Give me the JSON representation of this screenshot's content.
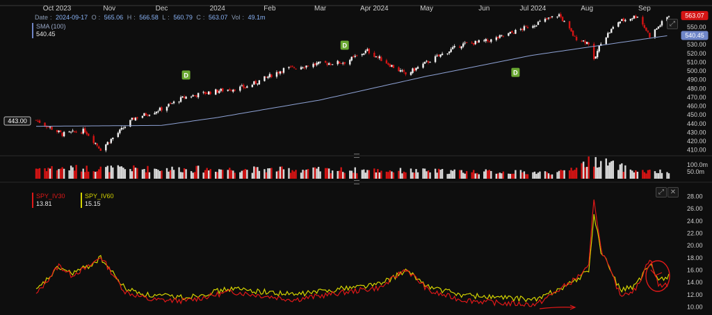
{
  "header": {
    "date_label": "Date",
    "date": "2024-09-17",
    "open_label": "O",
    "open": "565.06",
    "high_label": "H",
    "high": "566.58",
    "low_label": "L",
    "low": "560.79",
    "close_label": "C",
    "close": "563.07",
    "vol_label": "Vol",
    "vol": "49.1m"
  },
  "sma": {
    "name": "SMA (100)",
    "value": "540.45"
  },
  "price_tags": {
    "last": "563.07",
    "sma": "540.45",
    "crosshair": "443.00"
  },
  "iv_legend": {
    "iv30_name": "SPY_IV30",
    "iv30_value": "13.81",
    "iv60_name": "SPY_IV60",
    "iv60_value": "15.15"
  },
  "colors": {
    "background": "#0e0e0e",
    "up_candle": "#f2f2f2",
    "down_candle": "#d41414",
    "sma_line": "#8fa3d6",
    "iv30": "#e01818",
    "iv60": "#d4d400",
    "dividend_badge": "#6aa832",
    "annotation": "#e01818"
  },
  "toolbar_icons": [
    "expand-icon",
    "close-icon"
  ],
  "chart_data": [
    {
      "type": "candlestick",
      "title": "",
      "x_tick_labels": [
        "Oct 2023",
        "Nov",
        "Dec",
        "2024",
        "Feb",
        "Mar",
        "Apr 2024",
        "May",
        "Jun",
        "Jul 2024",
        "Aug",
        "Sep"
      ],
      "x_tick_dates": [
        "2023-10-02",
        "2023-11-01",
        "2023-12-01",
        "2024-01-02",
        "2024-02-01",
        "2024-03-01",
        "2024-04-01",
        "2024-05-01",
        "2024-06-03",
        "2024-07-01",
        "2024-08-01",
        "2024-09-03"
      ],
      "x_range": [
        "2023-09-20",
        "2024-09-17"
      ],
      "y_tick_labels": [
        "410.00",
        "420.00",
        "430.00",
        "440.00",
        "450.00",
        "460.00",
        "470.00",
        "480.00",
        "490.00",
        "500.00",
        "510.00",
        "520.00",
        "530.00",
        "540.00",
        "550.00"
      ],
      "ylim": [
        405,
        565
      ],
      "series": [
        {
          "name": "",
          "x": [
            "2023-09-20",
            "2023-10-05",
            "2023-10-18",
            "2023-10-27",
            "2023-11-15",
            "2023-11-30",
            "2023-12-14",
            "2023-12-29",
            "2024-01-19",
            "2024-02-09",
            "2024-02-28",
            "2024-03-15",
            "2024-03-28",
            "2024-04-19",
            "2024-05-03",
            "2024-05-21",
            "2024-06-07",
            "2024-06-21",
            "2024-07-16",
            "2024-07-25",
            "2024-08-02",
            "2024-08-05",
            "2024-08-09",
            "2024-08-19",
            "2024-08-30",
            "2024-09-06",
            "2024-09-17"
          ],
          "close": [
            444,
            428,
            432,
            411,
            446,
            456,
            470,
            476,
            482,
            502,
            508,
            510,
            523,
            496,
            512,
            530,
            535,
            545,
            564,
            538,
            532,
            511,
            533,
            556,
            563,
            540,
            563.07
          ]
        },
        {
          "name": "SMA (100)",
          "x": [
            "2023-09-20",
            "2023-12-01",
            "2024-01-02",
            "2024-03-01",
            "2024-05-01",
            "2024-07-01",
            "2024-09-17"
          ],
          "values": [
            437,
            438,
            447,
            467,
            494,
            518,
            540.45
          ]
        }
      ],
      "dividend_markers": [
        {
          "label": "D",
          "date": "2023-12-15",
          "value": 495
        },
        {
          "label": "D",
          "date": "2024-03-15",
          "value": 529
        },
        {
          "label": "D",
          "date": "2024-06-21",
          "value": 498
        }
      ]
    },
    {
      "type": "bar",
      "title": "",
      "y_tick_labels": [
        "100.0m",
        "50.0m"
      ],
      "ylim": [
        0,
        140
      ],
      "series": [
        {
          "name": "",
          "x": [
            "2023-09-20",
            "2023-11-15",
            "2024-01-19",
            "2024-03-15",
            "2024-05-21",
            "2024-07-16",
            "2024-08-05",
            "2024-08-30",
            "2024-09-17"
          ],
          "values": [
            80,
            75,
            70,
            65,
            55,
            45,
            140,
            55,
            49.1
          ]
        }
      ]
    },
    {
      "type": "line",
      "title": "",
      "y_tick_labels": [
        "10.00",
        "12.00",
        "14.00",
        "16.00",
        "18.00",
        "20.00",
        "22.00",
        "24.00",
        "26.00",
        "28.00"
      ],
      "ylim": [
        9.5,
        28.5
      ],
      "series": [
        {
          "name": "SPY_IV30",
          "x": [
            "2023-09-20",
            "2023-10-03",
            "2023-10-10",
            "2023-10-20",
            "2023-10-27",
            "2023-11-10",
            "2023-11-24",
            "2023-12-15",
            "2024-01-10",
            "2024-02-15",
            "2024-03-15",
            "2024-04-05",
            "2024-04-19",
            "2024-05-03",
            "2024-05-21",
            "2024-06-14",
            "2024-07-03",
            "2024-07-25",
            "2024-08-02",
            "2024-08-05",
            "2024-08-09",
            "2024-08-20",
            "2024-08-29",
            "2024-09-06",
            "2024-09-11",
            "2024-09-17"
          ],
          "values": [
            12,
            16.8,
            15.2,
            16.5,
            18.2,
            12.5,
            11.2,
            11.0,
            12.5,
            11.2,
            12.4,
            13.2,
            16.2,
            12.5,
            11.2,
            10.6,
            10.4,
            14.5,
            16.5,
            27.8,
            19.5,
            12.0,
            12.8,
            18.0,
            13.5,
            13.81
          ]
        },
        {
          "name": "SPY_IV60",
          "x": [
            "2023-09-20",
            "2023-10-03",
            "2023-10-10",
            "2023-10-20",
            "2023-10-27",
            "2023-11-10",
            "2023-11-24",
            "2023-12-15",
            "2024-01-10",
            "2024-02-15",
            "2024-03-15",
            "2024-04-05",
            "2024-04-19",
            "2024-05-03",
            "2024-05-21",
            "2024-06-14",
            "2024-07-03",
            "2024-07-25",
            "2024-08-02",
            "2024-08-05",
            "2024-08-09",
            "2024-08-20",
            "2024-08-29",
            "2024-09-06",
            "2024-09-11",
            "2024-09-17"
          ],
          "values": [
            12.6,
            16.5,
            15.5,
            16.6,
            18.0,
            13.0,
            11.9,
            11.6,
            13.0,
            12.0,
            13.1,
            13.8,
            15.9,
            13.2,
            12.0,
            11.5,
            11.2,
            14.2,
            16.0,
            25.0,
            19.2,
            12.8,
            13.4,
            17.0,
            14.4,
            15.15
          ]
        }
      ]
    }
  ]
}
